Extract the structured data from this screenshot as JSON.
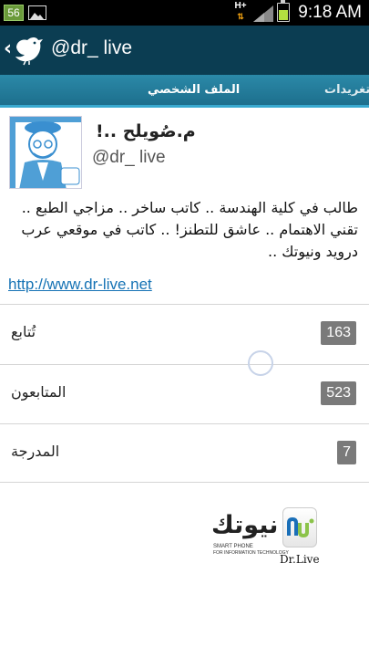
{
  "status_bar": {
    "notification_badge": "56",
    "network_type": "H+",
    "time": "9:18 AM",
    "icons": [
      "image-icon",
      "signal-icon",
      "battery-icon"
    ]
  },
  "action_bar": {
    "title": "@dr_ live",
    "icons": [
      "back-chevron-icon",
      "bird-icon"
    ],
    "background": "#0b3d52"
  },
  "tabs": [
    {
      "label": "الملف الشخصي",
      "active": true
    },
    {
      "label": "تغريدات",
      "active": false
    }
  ],
  "profile": {
    "display_name": "م.صُويلح ..!",
    "screen_name": "@dr_ live",
    "bio": "طالب في كلية الهندسة .. كاتب ساخر .. مزاجي الطبع .. تقني الاهتمام .. عاشق للتطنز! .. كاتب في موقعي عرب درويد ونيوتك ..",
    "url": "http://www.dr-live.net"
  },
  "stats": [
    {
      "label": "تُتابع",
      "count": "163"
    },
    {
      "label": "المتابعون",
      "count": "523"
    },
    {
      "label": "المدرجة",
      "count": "7"
    }
  ],
  "watermark": {
    "arabic": "نيوتك",
    "line1": "SMART PHONE",
    "line2": "FOR INFORMATION TECHNOLOGY",
    "signature": "Dr.Live"
  },
  "colors": {
    "accent": "#1d6f8d",
    "link": "#1673b5",
    "badge": "#7a7a7a"
  }
}
